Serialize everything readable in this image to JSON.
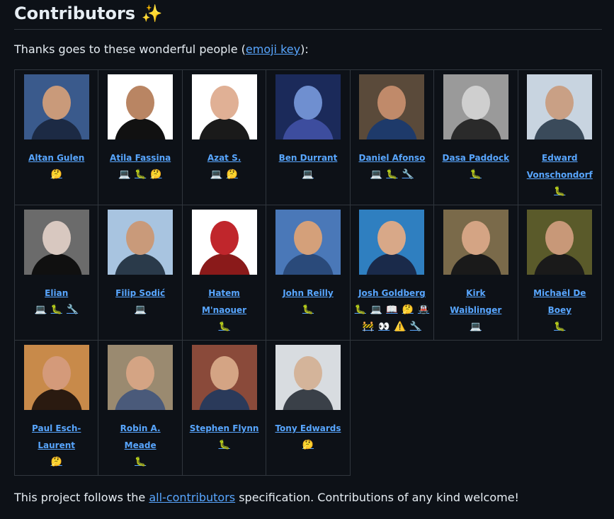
{
  "title": "Contributors",
  "title_emoji": "✨",
  "intro": {
    "prefix": "Thanks goes to these wonderful people (",
    "link": "emoji key",
    "suffix": "):"
  },
  "footer": {
    "prefix": "This project follows the ",
    "link": "all-contributors",
    "suffix": " specification. Contributions of any kind welcome!"
  },
  "rows": [
    [
      {
        "name": "Altan Gulen",
        "emojis": [
          "🤔"
        ],
        "bg": "#3a5a8c",
        "skin": "#c99a7a",
        "shirt": "#1c2a44"
      },
      {
        "name": "Atila Fassina",
        "emojis": [
          "💻",
          "🐛",
          "🤔"
        ],
        "bg": "#ffffff",
        "skin": "#b98563",
        "shirt": "#111111"
      },
      {
        "name": "Azat S.",
        "emojis": [
          "💻",
          "🤔"
        ],
        "bg": "#ffffff",
        "skin": "#e0b095",
        "shirt": "#1a1a1a"
      },
      {
        "name": "Ben Durrant",
        "emojis": [
          "💻"
        ],
        "bg": "#1b2a5a",
        "skin": "#6f8fd0",
        "shirt": "#3d4d9e"
      },
      {
        "name": "Daniel Afonso",
        "emojis": [
          "💻",
          "🐛",
          "🔧"
        ],
        "bg": "#5a4a3a",
        "skin": "#c08a6a",
        "shirt": "#1e3a6a"
      },
      {
        "name": "Dasa Paddock",
        "emojis": [
          "🐛"
        ],
        "bg": "#9a9a9a",
        "skin": "#cfcfcf",
        "shirt": "#2a2a2a"
      },
      {
        "name": "Edward Vonschondorf",
        "emojis": [
          "🐛"
        ],
        "bg": "#c8d4e0",
        "skin": "#c9a085",
        "shirt": "#3a4a5a"
      }
    ],
    [
      {
        "name": "Elian",
        "emojis": [
          "💻",
          "🐛",
          "🔧"
        ],
        "bg": "#6b6b6b",
        "skin": "#d8c8c0",
        "shirt": "#101010"
      },
      {
        "name": "Filip Sodić",
        "emojis": [
          "💻"
        ],
        "bg": "#a8c4e0",
        "skin": "#c99a7a",
        "shirt": "#2a3a4a"
      },
      {
        "name": "Hatem M'naouer",
        "emojis": [
          "🐛"
        ],
        "bg": "#ffffff",
        "skin": "#c0262c",
        "shirt": "#8a1a1a"
      },
      {
        "name": "John Reilly",
        "emojis": [
          "🐛"
        ],
        "bg": "#4a78b8",
        "skin": "#d4a07a",
        "shirt": "#2a4a7a"
      },
      {
        "name": "Josh Goldberg",
        "emojis": [
          "🐛",
          "💻",
          "📖",
          "🤔",
          "🚇",
          "🚧",
          "👀",
          "⚠️",
          "🔧"
        ],
        "bg": "#2f7fc0",
        "skin": "#d8a888",
        "shirt": "#1a2a4a"
      },
      {
        "name": "Kirk Waiblinger",
        "emojis": [
          "💻"
        ],
        "bg": "#7a6a4a",
        "skin": "#d4a484",
        "shirt": "#1a1a1a"
      },
      {
        "name": "Michaël De Boey",
        "emojis": [
          "🐛"
        ],
        "bg": "#5a5a2a",
        "skin": "#c89878",
        "shirt": "#1a1a1a"
      }
    ],
    [
      {
        "name": "Paul Esch-Laurent",
        "emojis": [
          "🤔"
        ],
        "bg": "#c88a4a",
        "skin": "#d49a7a",
        "shirt": "#2a1a10"
      },
      {
        "name": "Robin A. Meade",
        "emojis": [
          "🐛"
        ],
        "bg": "#9a8a70",
        "skin": "#d4a484",
        "shirt": "#4a5a7a"
      },
      {
        "name": "Stephen Flynn",
        "emojis": [
          "🐛"
        ],
        "bg": "#8a4a3a",
        "skin": "#d4a484",
        "shirt": "#2a3a5a"
      },
      {
        "name": "Tony Edwards",
        "emojis": [
          "🤔"
        ],
        "bg": "#d8dce0",
        "skin": "#d4b49a",
        "shirt": "#3a4048"
      }
    ]
  ]
}
